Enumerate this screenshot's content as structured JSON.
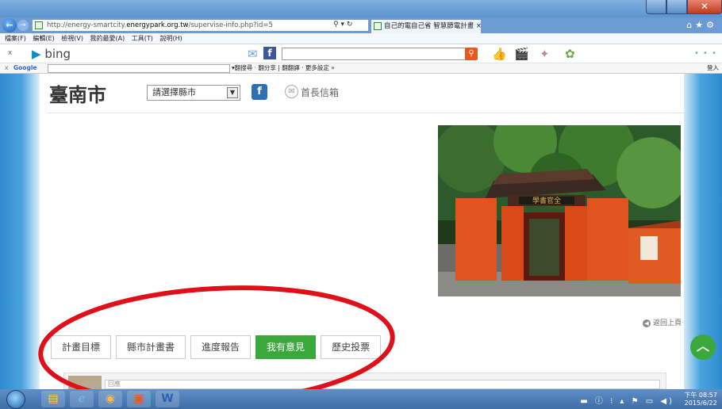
{
  "browser": {
    "url": "http://energy-smartcity.energypark.org.tw/supervise-info.php?id=5",
    "url_prefix": "http://energy-smartcity.",
    "url_domain": "energypark.org.tw",
    "url_path": "/supervise-info.php?id=5",
    "tab_title": "自己的電自己省 智慧節電計畫",
    "addr_tools": "⚲ ▾ ↻"
  },
  "menu": [
    "檔案(F)",
    "編輯(E)",
    "檢視(V)",
    "我的最愛(A)",
    "工具(T)",
    "說明(H)"
  ],
  "bing": {
    "label": "bing"
  },
  "google_bar": {
    "logo": "Google",
    "tools": "▾翻搜尋 · 翻分享 | 翻翻譯 · 更多設定 »",
    "login": "登入"
  },
  "site": {
    "city_title": "臺南市",
    "county_select": "請選擇縣市",
    "fb_label": "f",
    "mayor_mail": "首長信箱",
    "back_to_top": "返回上頁",
    "tabs": [
      {
        "label": "計畫目標",
        "active": false
      },
      {
        "label": "縣市計畫書",
        "active": false
      },
      {
        "label": "進度報告",
        "active": false
      },
      {
        "label": "我有意見",
        "active": true
      },
      {
        "label": "歷史投票",
        "active": false
      }
    ],
    "comment_placeholder": "回應"
  },
  "taskbar": {
    "clock_time": "下午 08:57",
    "clock_date": "2015/6/22"
  },
  "colors": {
    "accent_green": "#3aa83d",
    "annotation_red": "#e0101a"
  }
}
